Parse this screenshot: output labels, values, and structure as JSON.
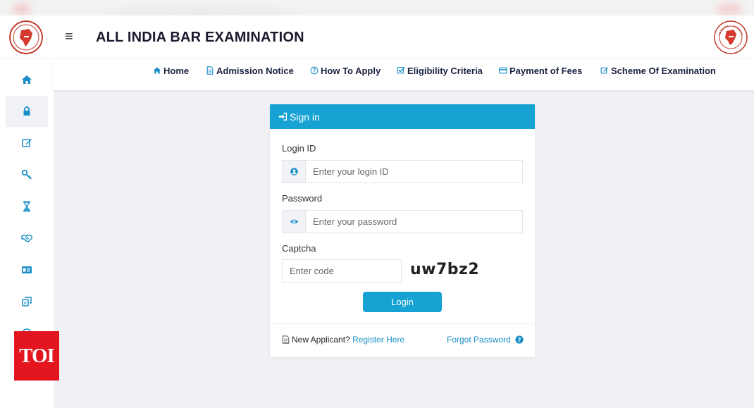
{
  "header": {
    "menu_icon": "hamburger-icon",
    "title": "ALL INDIA BAR EXAMINATION"
  },
  "sidebar": {
    "items": [
      {
        "icon": "home-icon",
        "active": false
      },
      {
        "icon": "lock-icon",
        "active": true
      },
      {
        "icon": "edit-icon",
        "active": false
      },
      {
        "icon": "key-icon",
        "active": false
      },
      {
        "icon": "hourglass-icon",
        "active": false
      },
      {
        "icon": "handshake-icon",
        "active": false
      },
      {
        "icon": "id-card-icon",
        "active": false
      },
      {
        "icon": "copy-icon",
        "active": false
      }
    ]
  },
  "nav": {
    "items": [
      {
        "label": "Home",
        "icon": "home-icon"
      },
      {
        "label": "Admission Notice",
        "icon": "document-icon"
      },
      {
        "label": "How To Apply",
        "icon": "question-circle-icon"
      },
      {
        "label": "Eligibility Criteria",
        "icon": "check-square-icon"
      },
      {
        "label": "Payment of Fees",
        "icon": "credit-card-icon"
      },
      {
        "label": "Scheme Of Examination",
        "icon": "edit-icon"
      }
    ]
  },
  "signin": {
    "title": "Sign in",
    "login_label": "Login ID",
    "login_placeholder": "Enter your login ID",
    "password_label": "Password",
    "password_placeholder": "Enter your password",
    "captcha_label": "Captcha",
    "captcha_placeholder": "Enter code",
    "captcha_code": "uw7bz2",
    "login_button": "Login",
    "new_applicant_text": "New Applicant?",
    "register_link": "Register Here",
    "forgot_link": "Forgot Password"
  },
  "watermark": "TOI",
  "colors": {
    "accent": "#17a2d4",
    "nav_text": "#1b2240",
    "icon_blue": "#1a8fc7",
    "watermark_red": "#e3161f"
  }
}
